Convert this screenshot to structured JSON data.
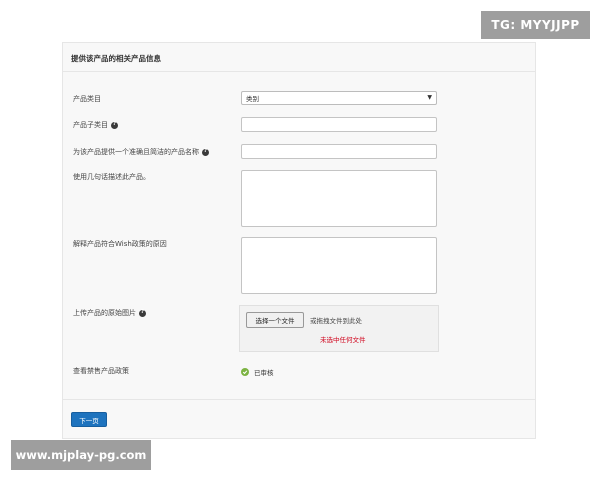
{
  "watermarks": {
    "top": "TG: MYYJJPP",
    "bottom": "www.mjplay-pg.com"
  },
  "form": {
    "title": "提供该产品的相关产品信息",
    "category": {
      "label": "产品类目",
      "selected": "类别"
    },
    "subcategory": {
      "label": "产品子类目"
    },
    "product_name": {
      "label": "为该产品提供一个准确且简洁的产品名称"
    },
    "description": {
      "label": "使用几句话描述此产品。"
    },
    "compliance_reason": {
      "label": "解释产品符合Wish政策的原因"
    },
    "upload": {
      "label": "上传产品的原始图片",
      "button": "选择一个文件",
      "drop_text": "或拖拽文件到此处",
      "no_file_text": "未选中任何文件"
    },
    "policy": {
      "label": "查看禁售产品政策",
      "status": "已审核"
    },
    "next_button": "下一页"
  },
  "colors": {
    "accent": "#1e73be",
    "error": "#d0021b",
    "success": "#7cb342"
  }
}
